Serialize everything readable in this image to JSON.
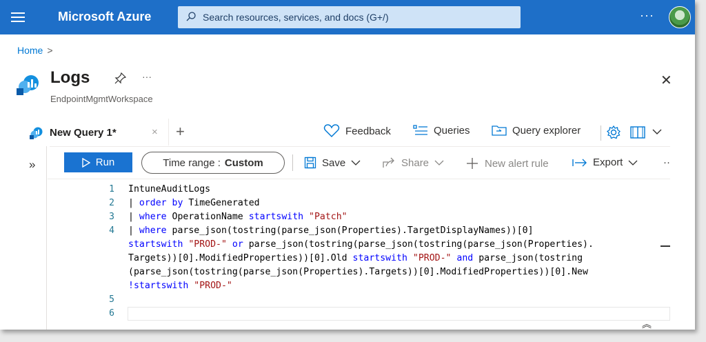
{
  "topbar": {
    "brand": "Microsoft Azure",
    "search_placeholder": "Search resources, services, and docs (G+/)",
    "ellipsis": "···",
    "accent_color": "#1e6fc8"
  },
  "breadcrumb": {
    "home": "Home",
    "separator": ">"
  },
  "header": {
    "title": "Logs",
    "subtitle": "EndpointMgmtWorkspace",
    "ellipsis": "···",
    "close": "✕"
  },
  "tabs": [
    {
      "label": "New Query 1*",
      "close": "×"
    }
  ],
  "tabbar": {
    "add": "+",
    "feedback": "Feedback",
    "queries": "Queries",
    "query_explorer": "Query explorer"
  },
  "toolbar": {
    "expand": "»",
    "run": "Run",
    "time_range_label": "Time range :",
    "time_range_value": "Custom",
    "save": "Save",
    "share": "Share",
    "new_alert_rule": "New alert rule",
    "export": "Export",
    "more": "··"
  },
  "editor": {
    "line_numbers": [
      "1",
      "2",
      "3",
      "4",
      "5",
      "6"
    ],
    "lines": {
      "l1": "IntuneAuditLogs",
      "l2_pipe": "| ",
      "l2_kw": "order by",
      "l2_rest": " TimeGenerated",
      "l3_pipe": "| ",
      "l3_kw": "where",
      "l3_mid": " OperationName ",
      "l3_kw2": "startswith",
      "l3_sp": " ",
      "l3_str": "\"Patch\"",
      "l4a_pipe": "| ",
      "l4a_kw": "where",
      "l4a_rest": " parse_json(tostring(parse_json(Properties).TargetDisplayNames))[0]",
      "l4b_kw": "startswith",
      "l4b_sp": " ",
      "l4b_str": "\"PROD-\"",
      "l4b_sp2": " ",
      "l4b_kw2": "or",
      "l4b_rest": " parse_json(tostring(parse_json(tostring(parse_json(Properties).",
      "l4c_a": "Targets))[0].ModifiedProperties))[0].Old ",
      "l4c_kw": "startswith",
      "l4c_sp": " ",
      "l4c_str": "\"PROD-\"",
      "l4c_sp2": " ",
      "l4c_kw2": "and",
      "l4c_rest": " parse_json(tostring",
      "l4d": "(parse_json(tostring(parse_json(Properties).Targets))[0].ModifiedProperties))[0].New",
      "l4e_kw": "!startswith",
      "l4e_sp": " ",
      "l4e_str": "\"PROD-\""
    },
    "collapse": "︽"
  }
}
